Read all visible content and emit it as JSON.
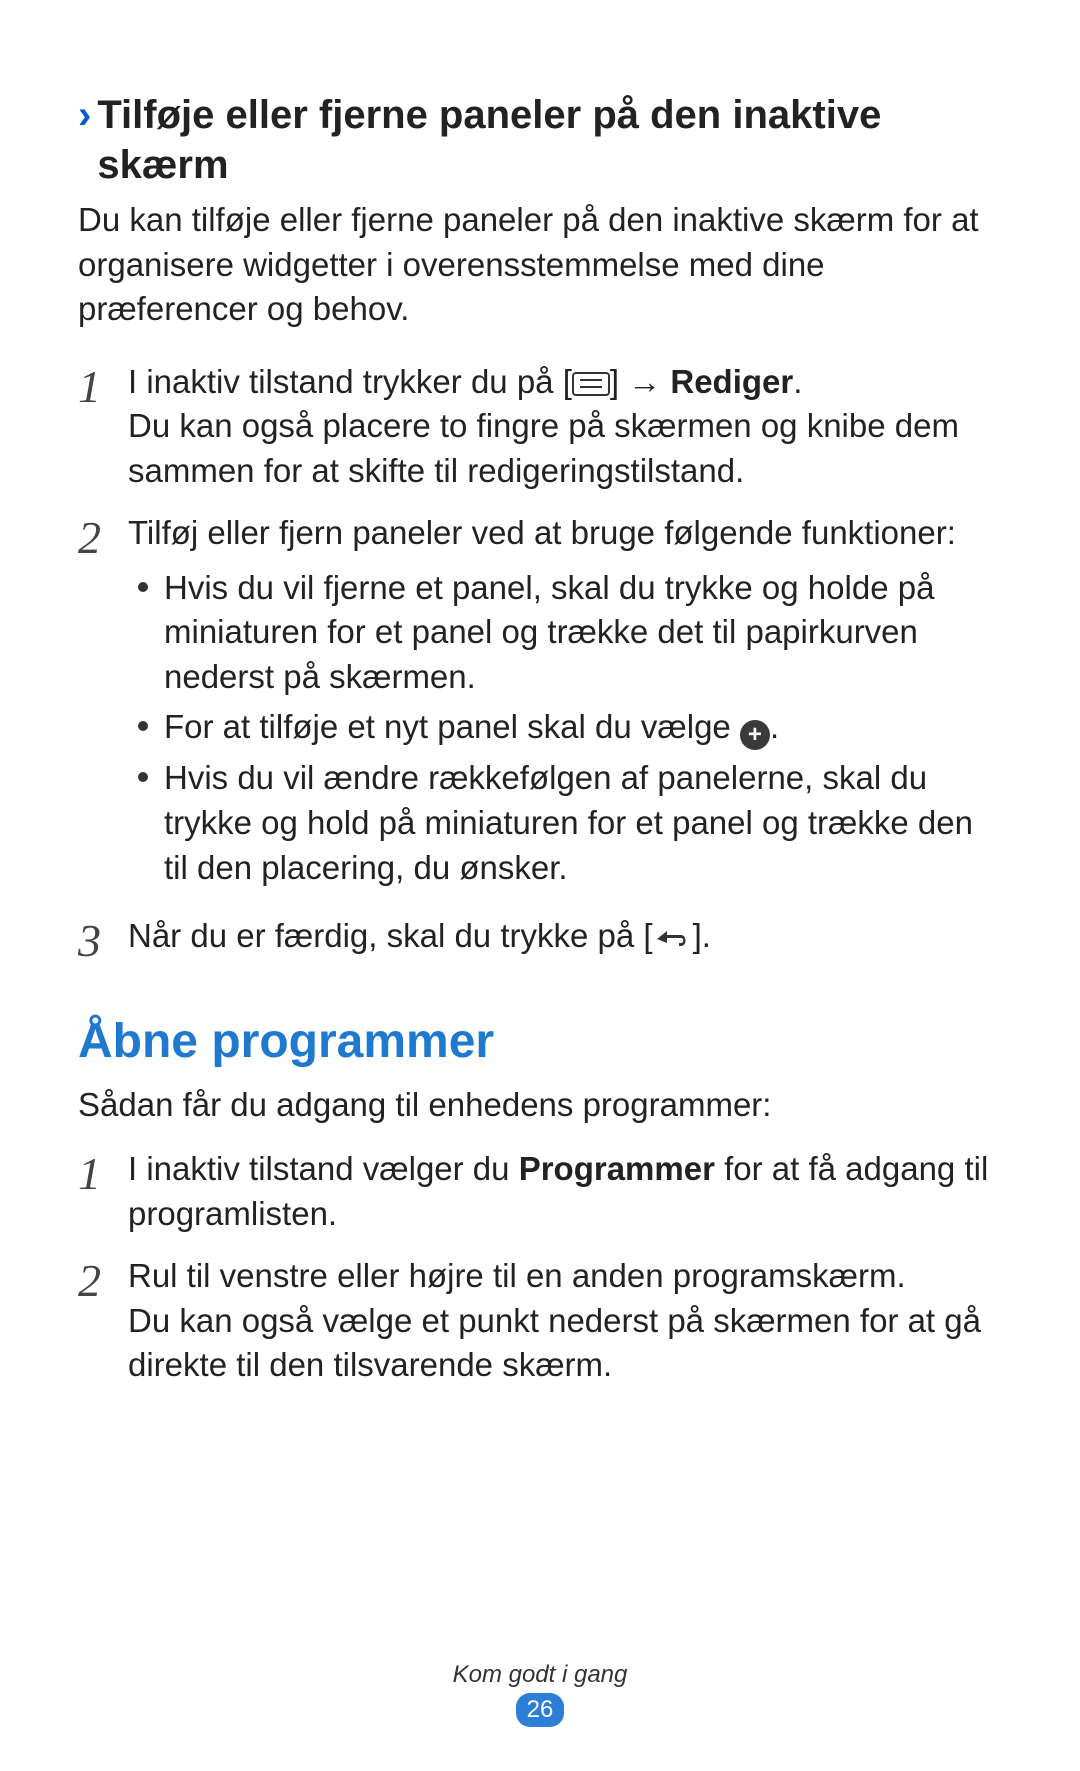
{
  "section1": {
    "heading_line1": "Tilføje eller fjerne paneler på den inaktive",
    "heading_line2": "skærm",
    "intro": "Du kan tilføje eller fjerne paneler på den inaktive skærm for at organisere widgetter i overensstemmelse med dine præferencer og behov.",
    "steps": {
      "s1": {
        "num": "1",
        "line1_before": "I inaktiv tilstand trykker du på [",
        "line1_arrow": " → ",
        "line1_bold": "Rediger",
        "line1_after": ".",
        "line2": "Du kan også placere to fingre på skærmen og knibe dem sammen for at skifte til redigeringstilstand."
      },
      "s2": {
        "num": "2",
        "line1": "Tilføj eller fjern paneler ved at bruge følgende funktioner:",
        "bullets": {
          "b1": "Hvis du vil fjerne et panel, skal du trykke og holde på miniaturen for et panel og trække det til papirkurven nederst på skærmen.",
          "b2_before": "For at tilføje et nyt panel skal du vælge ",
          "b2_after": ".",
          "b3": "Hvis du vil ændre rækkefølgen af panelerne, skal du trykke og hold på miniaturen for et panel og trække den til den placering, du ønsker."
        }
      },
      "s3": {
        "num": "3",
        "line1_before": "Når du er færdig, skal du trykke på [",
        "line1_after": "]."
      }
    }
  },
  "section2": {
    "title": "Åbne programmer",
    "intro": "Sådan får du adgang til enhedens programmer:",
    "steps": {
      "s1": {
        "num": "1",
        "before": "I inaktiv tilstand vælger du ",
        "bold": "Programmer",
        "after": " for at få adgang til programlisten."
      },
      "s2": {
        "num": "2",
        "line1": "Rul til venstre eller højre til en anden programskærm.",
        "line2": "Du kan også vælge et punkt nederst på skærmen for at gå direkte til den tilsvarende skærm."
      }
    }
  },
  "footer": {
    "label": "Kom godt i gang",
    "page": "26"
  }
}
